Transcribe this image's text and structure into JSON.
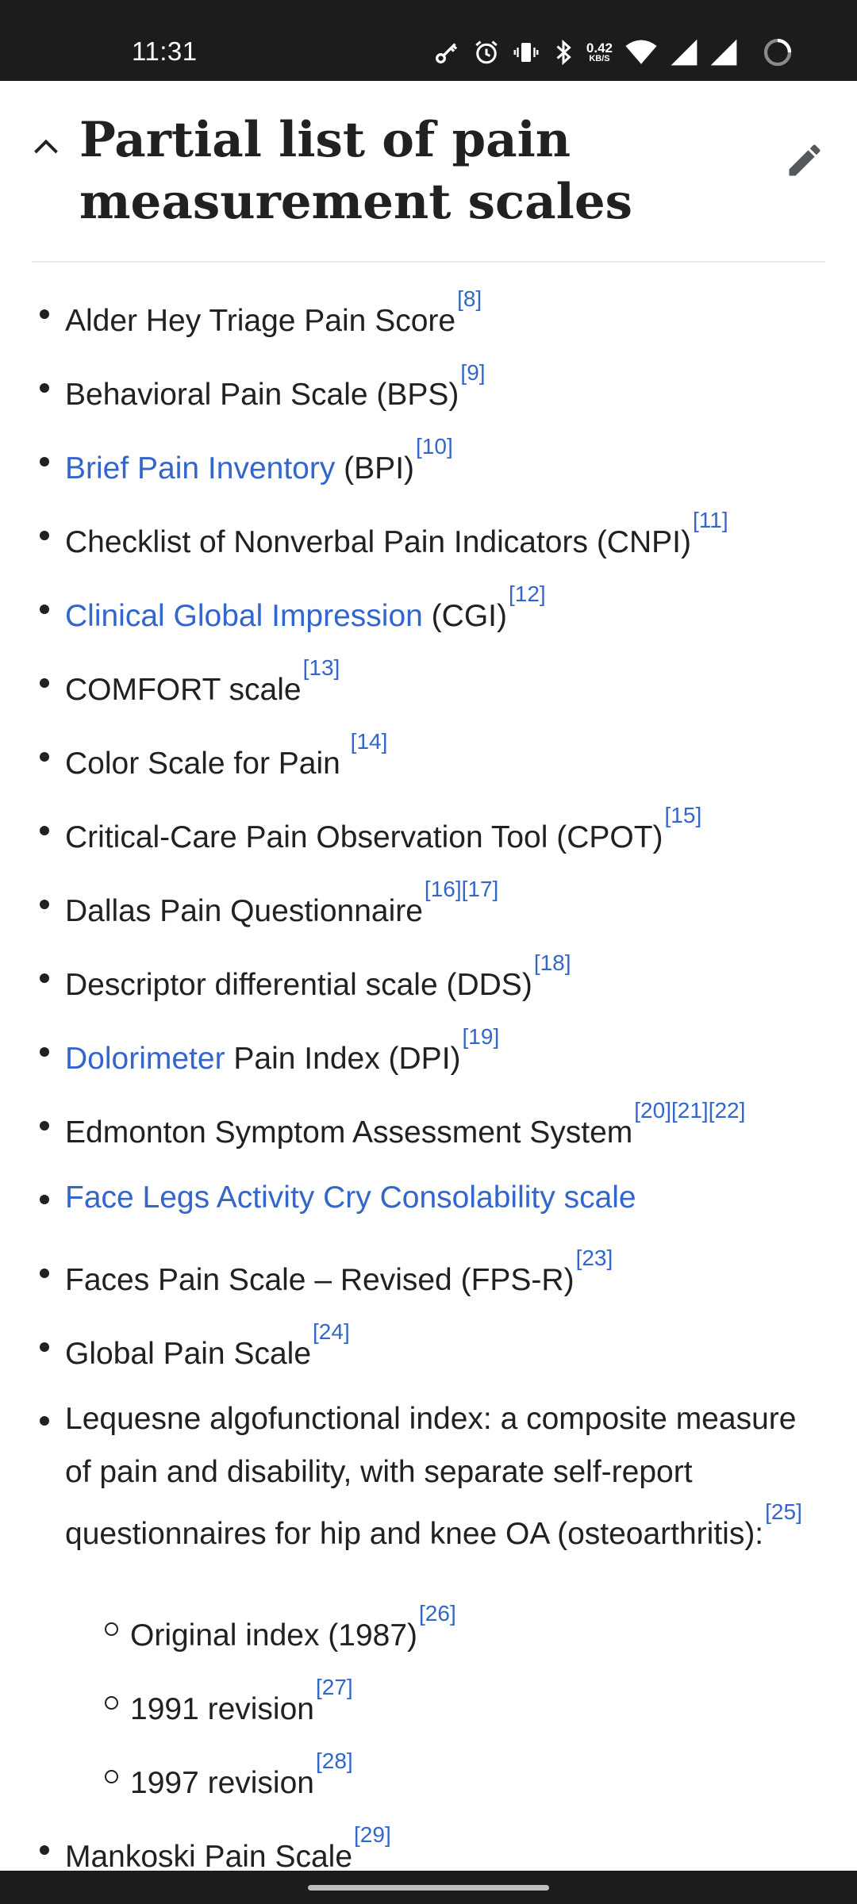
{
  "status_bar": {
    "time": "11:31",
    "net_speed_value": "0.42",
    "net_speed_unit": "KB/S",
    "icons": [
      "key-icon",
      "alarm-icon",
      "vibrate-icon",
      "bluetooth-icon",
      "wifi-icon",
      "signal-icon",
      "signal-icon",
      "loading-icon"
    ]
  },
  "section": {
    "title": "Partial list of pain measurement scales"
  },
  "colors": {
    "link": "#3366cc",
    "text": "#202122",
    "status_bar": "#1c1c1e"
  },
  "items": [
    {
      "text": "Alder Hey Triage Pain Score",
      "refs": "[8]"
    },
    {
      "text": "Behavioral Pain Scale (BPS)",
      "refs": "[9]"
    },
    {
      "link": "Brief Pain Inventory",
      "text": " (BPI)",
      "refs": "[10]"
    },
    {
      "text": "Checklist of Nonverbal Pain Indicators (CNPI)",
      "refs": "[11]"
    },
    {
      "link": "Clinical Global Impression",
      "text": " (CGI)",
      "refs": "[12]"
    },
    {
      "text": "COMFORT scale",
      "refs": "[13]"
    },
    {
      "text": "Color Scale for Pain ",
      "refs": "[14]"
    },
    {
      "text": "Critical-Care Pain Observation Tool (CPOT)",
      "refs": "[15]"
    },
    {
      "text": "Dallas Pain Questionnaire",
      "refs": "[16][17]"
    },
    {
      "text": "Descriptor differential scale (DDS)",
      "refs": "[18]"
    },
    {
      "link": "Dolorimeter",
      "text": " Pain Index (DPI)",
      "refs": "[19]"
    },
    {
      "text": "Edmonton Symptom Assessment System",
      "refs": "[20][21][22]"
    },
    {
      "link": "Face Legs Activity Cry Consolability scale"
    },
    {
      "text": "Faces Pain Scale – Revised (FPS-R)",
      "refs": "[23]"
    },
    {
      "text": "Global Pain Scale",
      "refs": "[24]"
    },
    {
      "text": "Lequesne algofunctional index: a composite measure of pain and disability, with separate self-report questionnaires for hip and knee OA (osteoarthritis):",
      "refs": "[25]"
    },
    {
      "text": "Original index (1987)",
      "refs": "[26]"
    },
    {
      "text": "1991 revision",
      "refs": "[27]"
    },
    {
      "text": "1997 revision",
      "refs": "[28]"
    },
    {
      "text": "Mankoski Pain Scale",
      "refs": "[29]"
    }
  ]
}
